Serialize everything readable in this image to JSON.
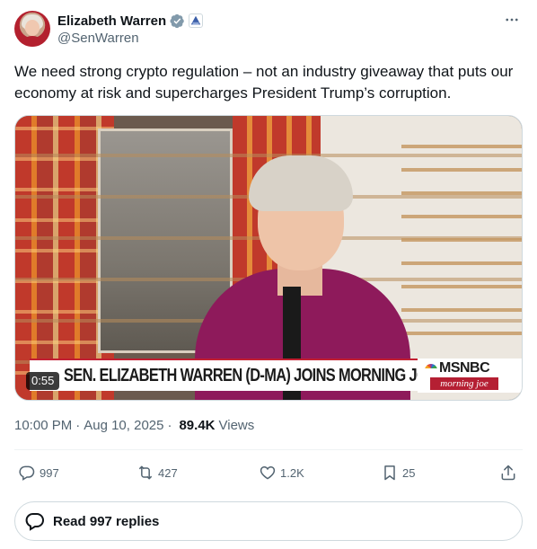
{
  "author": {
    "display_name": "Elizabeth Warren",
    "handle": "@SenWarren",
    "verified": true,
    "affiliation_badge": "us-senate-badge-icon"
  },
  "tweet": {
    "text": "We need strong crypto regulation – not an industry giveaway that puts our economy at risk and supercharges President Trump’s corruption."
  },
  "media": {
    "type": "video",
    "duration": "0:55",
    "chyron": "SEN. ELIZABETH WARREN (D-MA) JOINS MORNING JOE",
    "network": "MSNBC",
    "show": "morning joe"
  },
  "meta": {
    "time": "10:00 PM",
    "date": "Aug 10, 2025",
    "views_count": "89.4K",
    "views_label": "Views"
  },
  "actions": {
    "replies": "997",
    "reposts": "427",
    "likes": "1.2K",
    "bookmarks": "25"
  },
  "read_replies": {
    "label": "Read 997 replies"
  },
  "colors": {
    "text_primary": "#0f1419",
    "text_secondary": "#536471",
    "verified_blue": "#829aab",
    "border": "#cfd9de"
  }
}
